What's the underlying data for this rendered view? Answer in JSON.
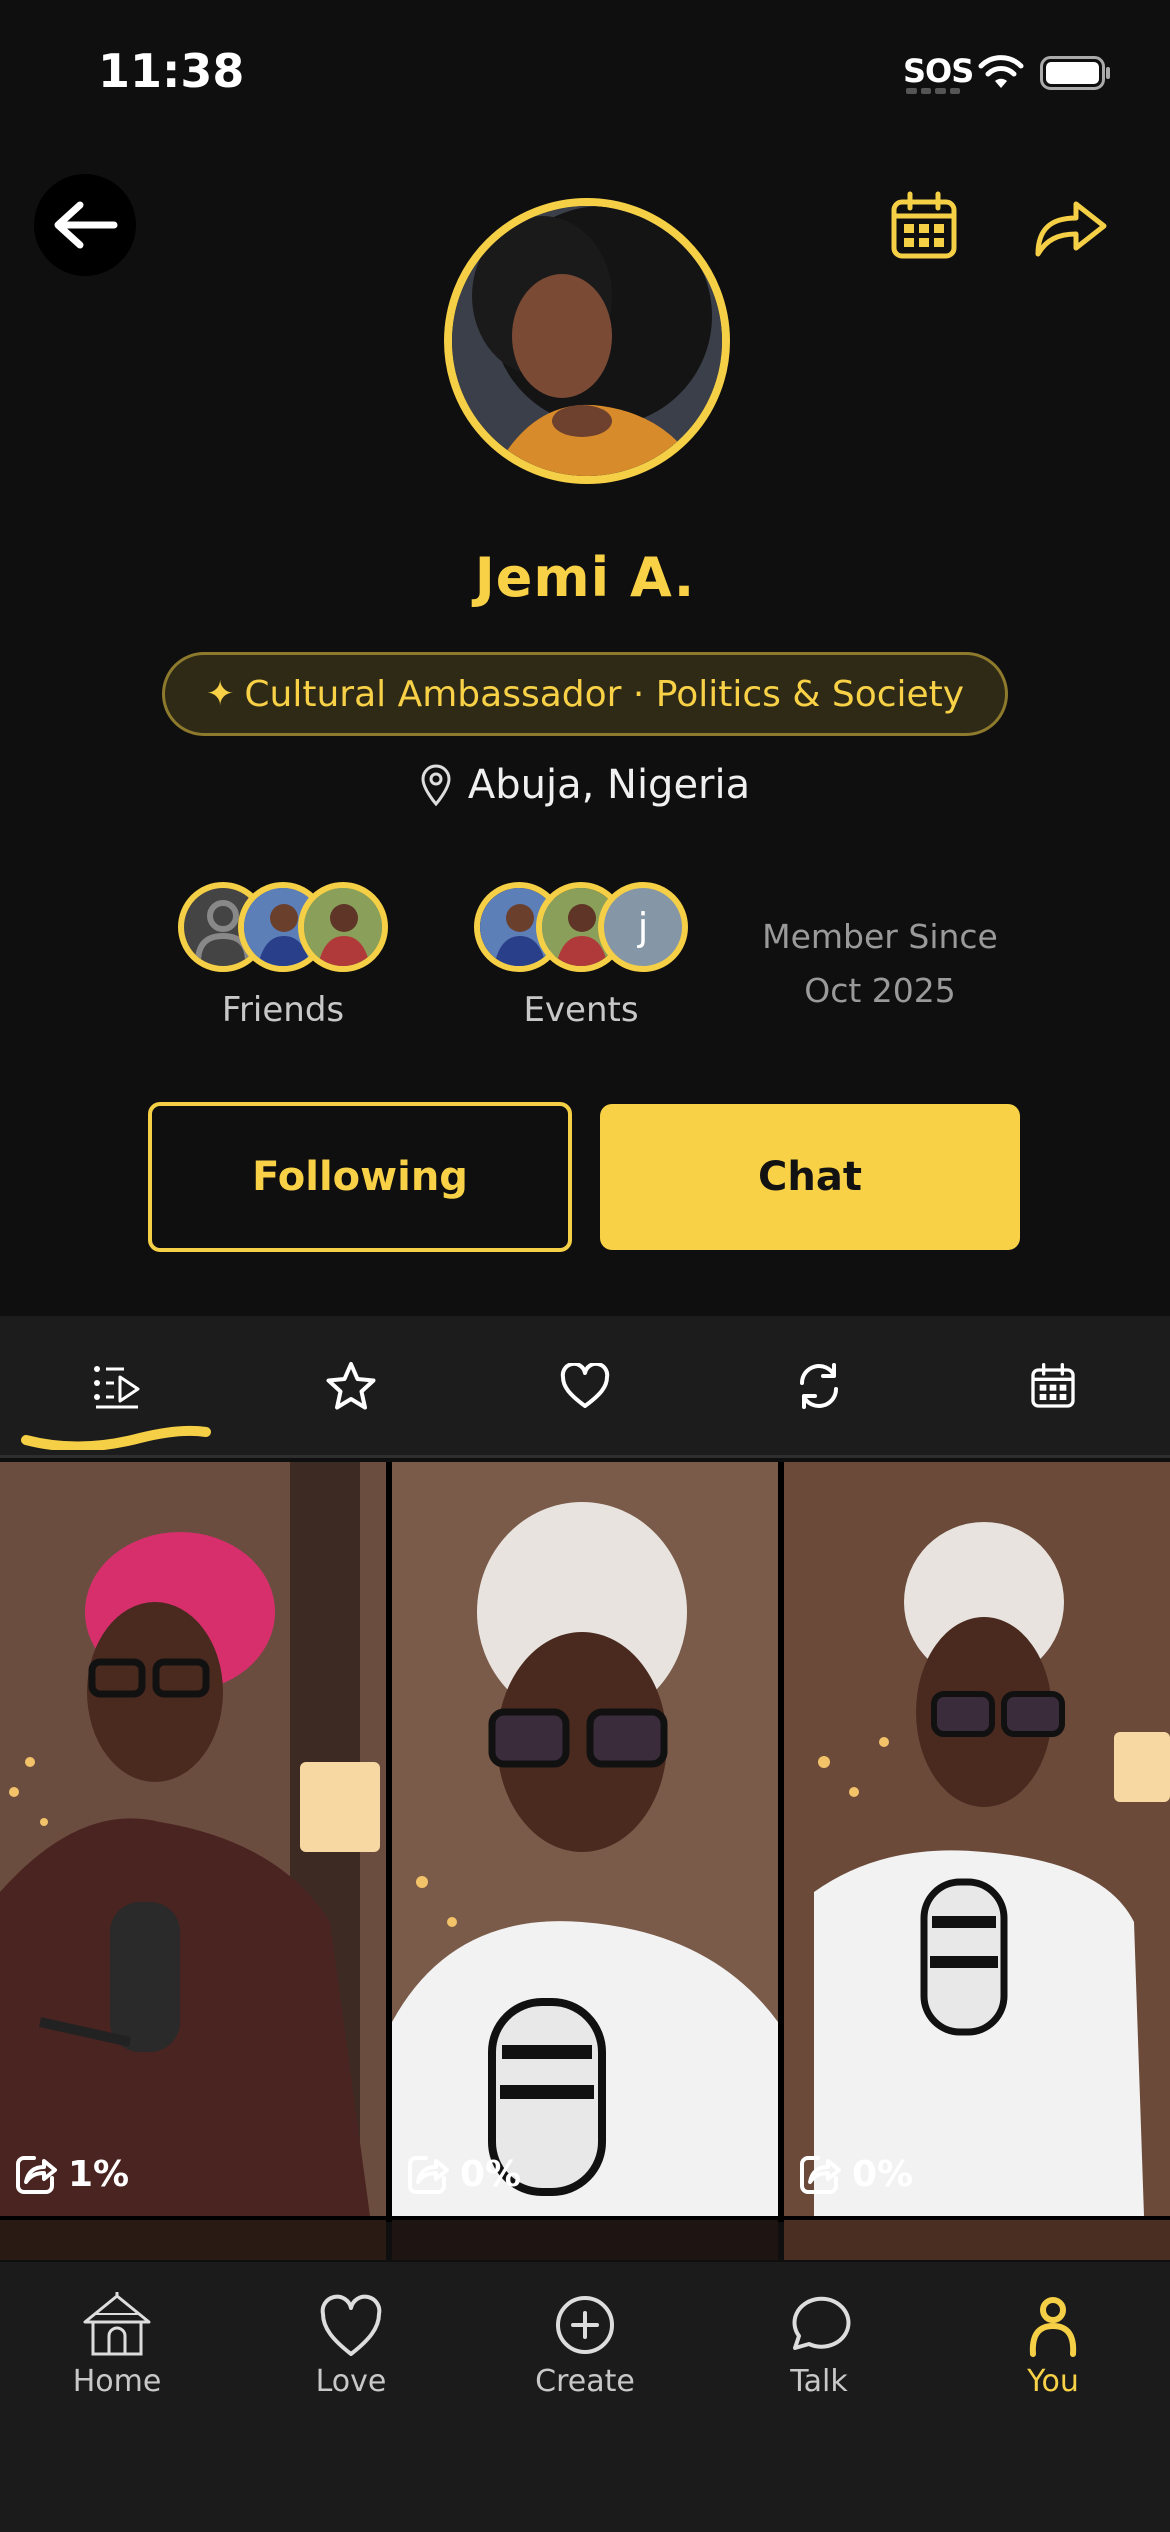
{
  "status_bar": {
    "time": "11:38",
    "sos": "SOS"
  },
  "profile": {
    "name": "Jemi A.",
    "role_badge": "Cultural Ambassador · Politics & Society",
    "location": "Abuja, Nigeria"
  },
  "stats": {
    "friends_label": "Friends",
    "events_label": "Events",
    "events_initial": "j",
    "member_since_label": "Member Since",
    "member_since_date": "Oct 2025"
  },
  "actions": {
    "following_label": "Following",
    "chat_label": "Chat"
  },
  "tabs": [
    {
      "icon": "playlist-icon",
      "active": true
    },
    {
      "icon": "star-icon"
    },
    {
      "icon": "heart-icon"
    },
    {
      "icon": "refresh-icon"
    },
    {
      "icon": "calendar-icon"
    }
  ],
  "videos": [
    {
      "share_percent": "1%"
    },
    {
      "share_percent": "0%"
    },
    {
      "share_percent": "0%"
    }
  ],
  "bottom_nav": [
    {
      "label": "Home",
      "icon": "hut-icon"
    },
    {
      "label": "Love",
      "icon": "heart-icon"
    },
    {
      "label": "Create",
      "icon": "plus-circle-icon"
    },
    {
      "label": "Talk",
      "icon": "chat-bubble-icon"
    },
    {
      "label": "You",
      "icon": "person-icon",
      "active": true
    }
  ],
  "colors": {
    "accent": "#f8d147",
    "background": "#0f0f0f",
    "surface": "#1c1c1c"
  }
}
